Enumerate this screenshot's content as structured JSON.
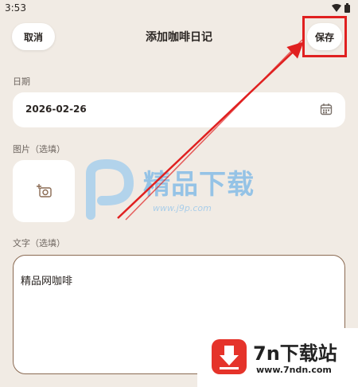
{
  "status_bar": {
    "time": "3:53"
  },
  "header": {
    "cancel_label": "取消",
    "title": "添加咖啡日记",
    "save_label": "保存"
  },
  "date_section": {
    "label": "日期",
    "value": "2026-02-26"
  },
  "image_section": {
    "label": "图片（选填）"
  },
  "text_section": {
    "label": "文字（选填）",
    "value": "精品网咖啡"
  },
  "watermarks": {
    "center_title": "精品下载",
    "center_url": "www.j9p.com",
    "brand_name": "7n下载站",
    "brand_url": "www.7ndn.com"
  },
  "icons": {
    "wifi": "wifi-icon",
    "battery": "battery-icon",
    "calendar": "calendar-icon",
    "add_photo": "add-photo-icon"
  },
  "colors": {
    "background": "#f1ebe4",
    "annotation": "#e02020",
    "text_border": "#8a6a52"
  }
}
